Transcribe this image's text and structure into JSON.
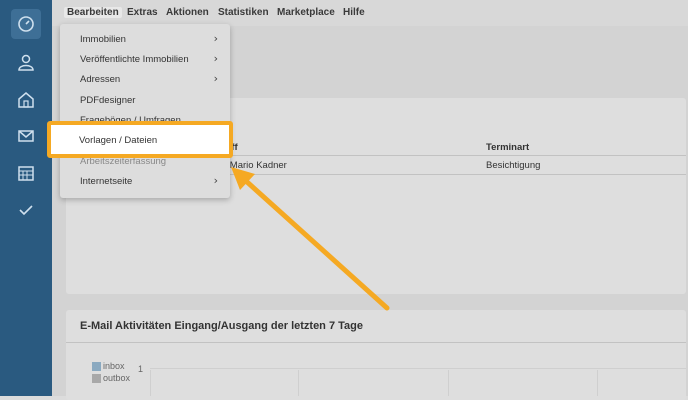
{
  "sidebar": {
    "icons": [
      "dashboard-icon",
      "user-icon",
      "home-icon",
      "mail-icon",
      "calendar-icon",
      "check-icon"
    ]
  },
  "menubar": {
    "items": [
      "Bearbeiten",
      "Extras",
      "Aktionen",
      "Statistiken",
      "Marketplace",
      "Hilfe"
    ]
  },
  "dropdown": {
    "items": [
      {
        "label": "Immobilien",
        "submenu": true
      },
      {
        "label": "Veröffentlichte Immobilien",
        "submenu": true
      },
      {
        "label": "Adressen",
        "submenu": true
      },
      {
        "label": "PDFdesigner",
        "submenu": false
      },
      {
        "label": "Fragebögen / Umfragen",
        "submenu": false
      },
      {
        "label": "Vorlagen / Dateien",
        "submenu": false
      },
      {
        "label": "Arbeitszeiterfassung",
        "submenu": false
      },
      {
        "label": "Internetseite",
        "submenu": true
      }
    ],
    "chevron": "›"
  },
  "table": {
    "headers": [
      "eff",
      "Terminart"
    ],
    "row": [
      "r Mario Kadner",
      "Besichtigung"
    ]
  },
  "email_panel": {
    "title": "E-Mail Aktivitäten Eingang/Ausgang der letzten 7 Tage",
    "legend": [
      {
        "label": "inbox",
        "color": "#8aa9c0"
      },
      {
        "label": "outbox",
        "color": "#a8a8a8"
      }
    ],
    "y_tick": "1"
  },
  "colors": {
    "highlight": "#f5a923",
    "sidebar": "#2a5a80"
  }
}
